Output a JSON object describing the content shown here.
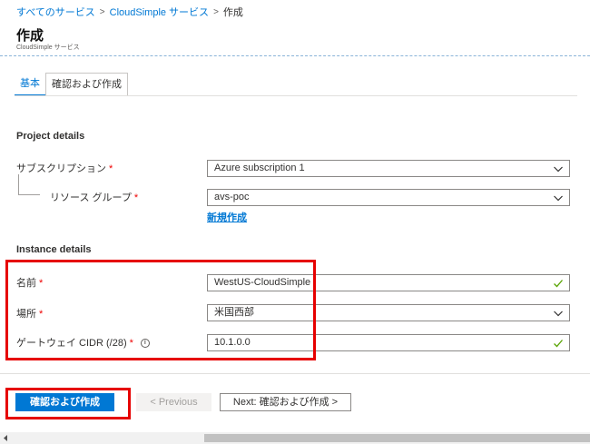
{
  "breadcrumb": {
    "items": [
      "すべてのサービス",
      "CloudSimple サービス"
    ],
    "current": "作成",
    "separator": ">"
  },
  "page": {
    "title": "作成",
    "subtitle": "CloudSimple サービス"
  },
  "tabs": [
    {
      "label": "基本",
      "active": true
    },
    {
      "label": "確認および作成",
      "active": false
    }
  ],
  "project_details": {
    "title": "Project details",
    "subscription": {
      "label": "サブスクリプション",
      "required": "*",
      "value": "Azure subscription 1"
    },
    "resource_group": {
      "label": "リソース グループ",
      "required": "*",
      "value": "avs-poc",
      "create_new_link": "新規作成"
    }
  },
  "instance_details": {
    "title": "Instance details",
    "name": {
      "label": "名前",
      "required": "*",
      "value": "WestUS-CloudSimple"
    },
    "location": {
      "label": "場所",
      "required": "*",
      "value": "米国西部"
    },
    "gateway_cidr": {
      "label": "ゲートウェイ CIDR (/28)",
      "required": "*",
      "info": "i",
      "value": "10.1.0.0"
    }
  },
  "footer": {
    "review_create_label": "確認および作成",
    "previous_label": "< Previous",
    "next_label": "Next: 確認および作成 >"
  },
  "colors": {
    "accent": "#0078d4",
    "highlight": "#e60000",
    "required": "#ee0000",
    "valid": "#57a300"
  }
}
